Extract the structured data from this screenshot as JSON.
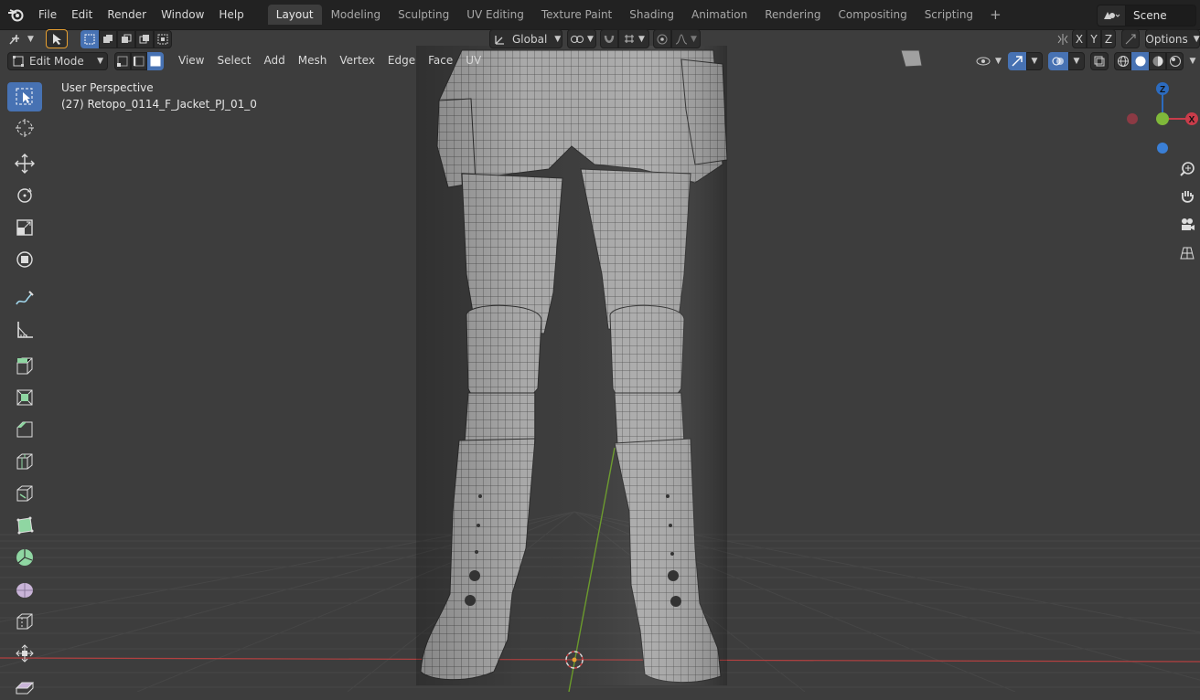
{
  "topbar": {
    "menus": [
      "File",
      "Edit",
      "Render",
      "Window",
      "Help"
    ],
    "workspaces": [
      "Layout",
      "Modeling",
      "Sculpting",
      "UV Editing",
      "Texture Paint",
      "Shading",
      "Animation",
      "Rendering",
      "Compositing",
      "Scripting"
    ],
    "active_workspace": "Layout",
    "add_tab": "+",
    "scene": "Scene"
  },
  "header": {
    "transform_orientation": "Global",
    "axes": [
      "X",
      "Y",
      "Z"
    ],
    "options": "Options"
  },
  "mode_header": {
    "mode": "Edit Mode",
    "menus": [
      "View",
      "Select",
      "Add",
      "Mesh",
      "Vertex",
      "Edge",
      "Face",
      "UV"
    ]
  },
  "viewport": {
    "perspective_label": "User Perspective",
    "object_label": "(27) Retopo_0114_F_Jacket_PJ_01_0",
    "background": "#3d3d3d",
    "x_axis_color": "#b24040",
    "y_axis_color": "#6a9a2a"
  },
  "gizmo": {
    "z": "Z",
    "x": "X",
    "y": "Y"
  },
  "toolbar": {
    "tools": [
      "select-box-icon",
      "cursor-icon",
      "move-icon",
      "rotate-icon",
      "scale-icon",
      "transform-icon",
      "annotate-icon",
      "measure-icon",
      "extrude-icon",
      "inset-icon",
      "bevel-icon",
      "loop-cut-icon",
      "knife-icon",
      "poly-build-icon",
      "spin-icon",
      "smooth-icon",
      "edge-slide-icon",
      "shrink-fatten-icon",
      "shear-icon"
    ]
  },
  "colors": {
    "accent": "#4772b3",
    "topbar": "#222222",
    "panel": "#2d2d2d"
  }
}
